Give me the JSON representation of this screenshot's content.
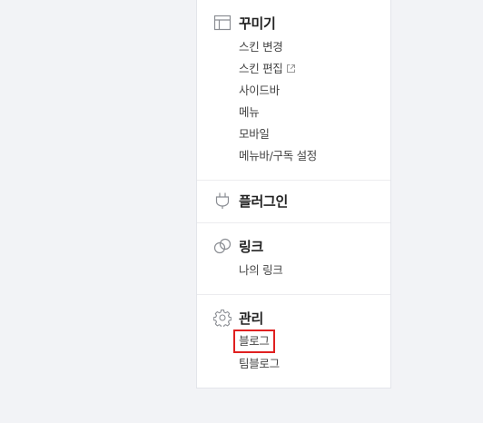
{
  "sections": [
    {
      "title": "꾸미기",
      "icon": "layout-icon",
      "items": [
        "스킨 변경",
        "스킨 편집",
        "사이드바",
        "메뉴",
        "모바일",
        "메뉴바/구독 설정"
      ]
    },
    {
      "title": "플러그인",
      "icon": "plug-icon",
      "items": []
    },
    {
      "title": "링크",
      "icon": "link-rings-icon",
      "items": [
        "나의 링크"
      ]
    },
    {
      "title": "관리",
      "icon": "gear-icon",
      "items": [
        "블로그",
        "팀블로그"
      ]
    }
  ],
  "external_link_icon": "external-link-icon",
  "highlight_color": "#e02020"
}
